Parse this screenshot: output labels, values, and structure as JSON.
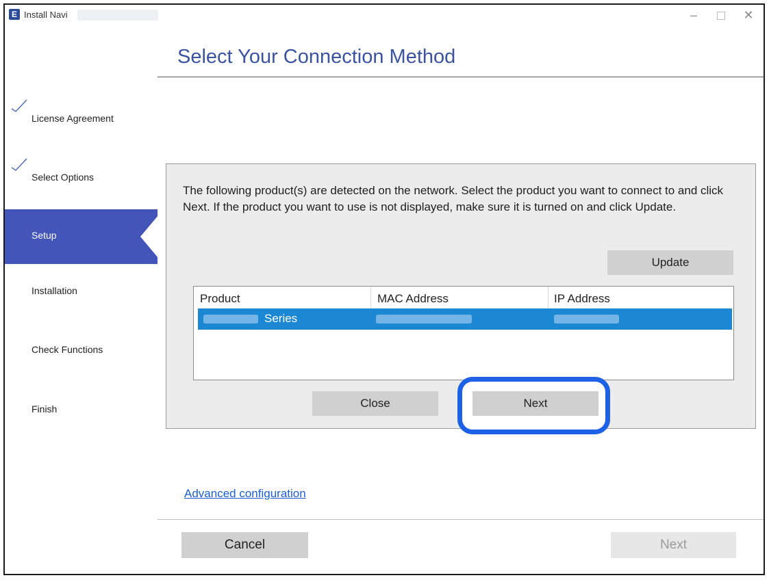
{
  "window": {
    "title": "Install Navi",
    "app_icon_letter": "E",
    "controls": {
      "minimize": "–",
      "maximize": "",
      "close": "✕"
    }
  },
  "sidebar": {
    "steps": [
      {
        "label": "License Agreement",
        "done": true
      },
      {
        "label": "Select Options",
        "done": true
      },
      {
        "label": "Setup",
        "active": true
      },
      {
        "label": "Installation"
      },
      {
        "label": "Check Functions"
      },
      {
        "label": "Finish"
      }
    ]
  },
  "main": {
    "title": "Select Your Connection Method",
    "instructions": "The following product(s) are detected on the network. Select the product you want to connect to and click Next. If the product you want to use is not displayed, make sure it is turned on and click Update.",
    "update_label": "Update",
    "table": {
      "columns": [
        "Product",
        "MAC Address",
        "IP Address"
      ],
      "rows": [
        {
          "product": "Series",
          "mac": "",
          "ip": "",
          "selected": true
        }
      ]
    },
    "close_label": "Close",
    "next_label": "Next"
  },
  "footer": {
    "advanced_link": "Advanced configuration",
    "cancel_label": "Cancel",
    "next_label": "Next"
  },
  "colors": {
    "accent": "#4355b8",
    "title": "#3953a0",
    "selection": "#1c88d4",
    "highlight_ring": "#1d62e6",
    "link": "#1a5fd4"
  }
}
